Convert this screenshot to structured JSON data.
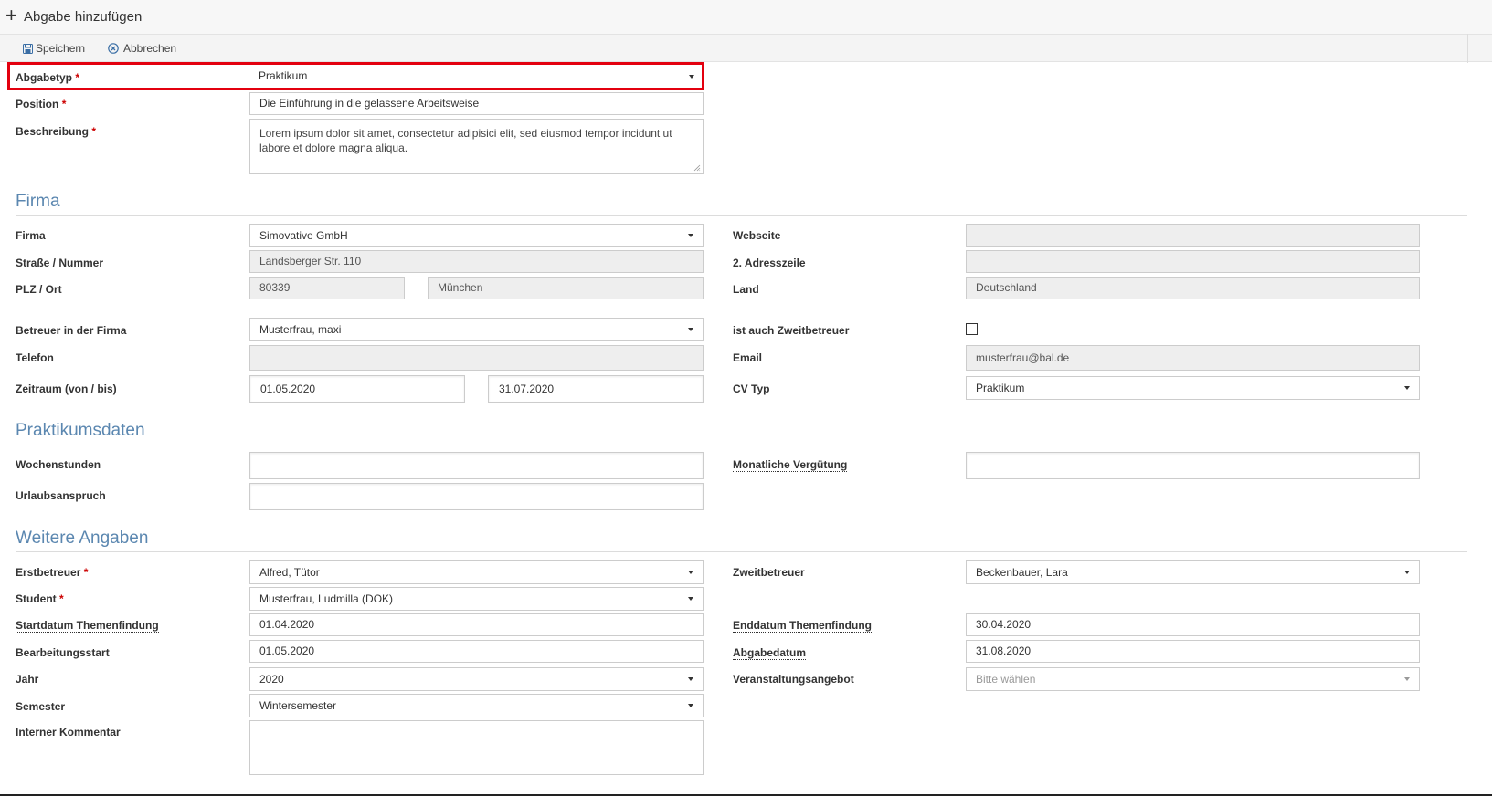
{
  "header": {
    "title": "Abgabe hinzufügen"
  },
  "toolbar": {
    "save_label": "Speichern",
    "cancel_label": "Abbrechen"
  },
  "form": {
    "abgabetyp": {
      "label": "Abgabetyp",
      "value": "Praktikum"
    },
    "position": {
      "label": "Position",
      "value": "Die Einführung in die gelassene Arbeitsweise"
    },
    "beschreibung": {
      "label": "Beschreibung",
      "value": "Lorem ipsum dolor sit amet, consectetur adipisici elit, sed eiusmod tempor incidunt ut labore et dolore magna aliqua."
    }
  },
  "sections": {
    "firma": "Firma",
    "praktikumsdaten": "Praktikumsdaten",
    "weitere": "Weitere Angaben"
  },
  "firma": {
    "firma": {
      "label": "Firma",
      "value": "Simovative GmbH"
    },
    "strasse": {
      "label": "Straße / Nummer",
      "value": "Landsberger Str. 110"
    },
    "plz_ort": {
      "label": "PLZ / Ort",
      "plz": "80339",
      "ort": "München"
    },
    "webseite": {
      "label": "Webseite",
      "value": ""
    },
    "adresszeile2": {
      "label": "2. Adresszeile",
      "value": ""
    },
    "land": {
      "label": "Land",
      "value": "Deutschland"
    },
    "betreuer": {
      "label": "Betreuer in der Firma",
      "value": "Musterfrau, maxi"
    },
    "telefon": {
      "label": "Telefon",
      "value": ""
    },
    "zeitraum": {
      "label": "Zeitraum (von / bis)",
      "von": "01.05.2020",
      "bis": "31.07.2020"
    },
    "zweitbetreuer_flag": {
      "label": "ist auch Zweitbetreuer",
      "checked": false
    },
    "email": {
      "label": "Email",
      "value": "musterfrau@bal.de"
    },
    "cv_typ": {
      "label": "CV Typ",
      "value": "Praktikum"
    }
  },
  "praktikum": {
    "wochenstunden": {
      "label": "Wochenstunden",
      "value": ""
    },
    "urlaubsanspruch": {
      "label": "Urlaubsanspruch",
      "value": ""
    },
    "verguetung": {
      "label": "Monatliche Vergütung",
      "value": ""
    }
  },
  "weitere": {
    "erstbetreuer": {
      "label": "Erstbetreuer",
      "value": "Alfred, Tütor"
    },
    "student": {
      "label": "Student",
      "value": "Musterfrau, Ludmilla (DOK)"
    },
    "startdatum": {
      "label": "Startdatum Themenfindung",
      "value": "01.04.2020"
    },
    "bearbeitungsstart": {
      "label": "Bearbeitungsstart",
      "value": "01.05.2020"
    },
    "jahr": {
      "label": "Jahr",
      "value": "2020"
    },
    "semester": {
      "label": "Semester",
      "value": "Wintersemester"
    },
    "kommentar": {
      "label": "Interner Kommentar",
      "value": ""
    },
    "zweitbetreuer": {
      "label": "Zweitbetreuer",
      "value": "Beckenbauer, Lara"
    },
    "enddatum": {
      "label": "Enddatum Themenfindung",
      "value": "30.04.2020"
    },
    "abgabedatum": {
      "label": "Abgabedatum",
      "value": "31.08.2020"
    },
    "veranstaltung": {
      "label": "Veranstaltungsangebot",
      "placeholder": "Bitte wählen"
    }
  },
  "required_marker": "*"
}
